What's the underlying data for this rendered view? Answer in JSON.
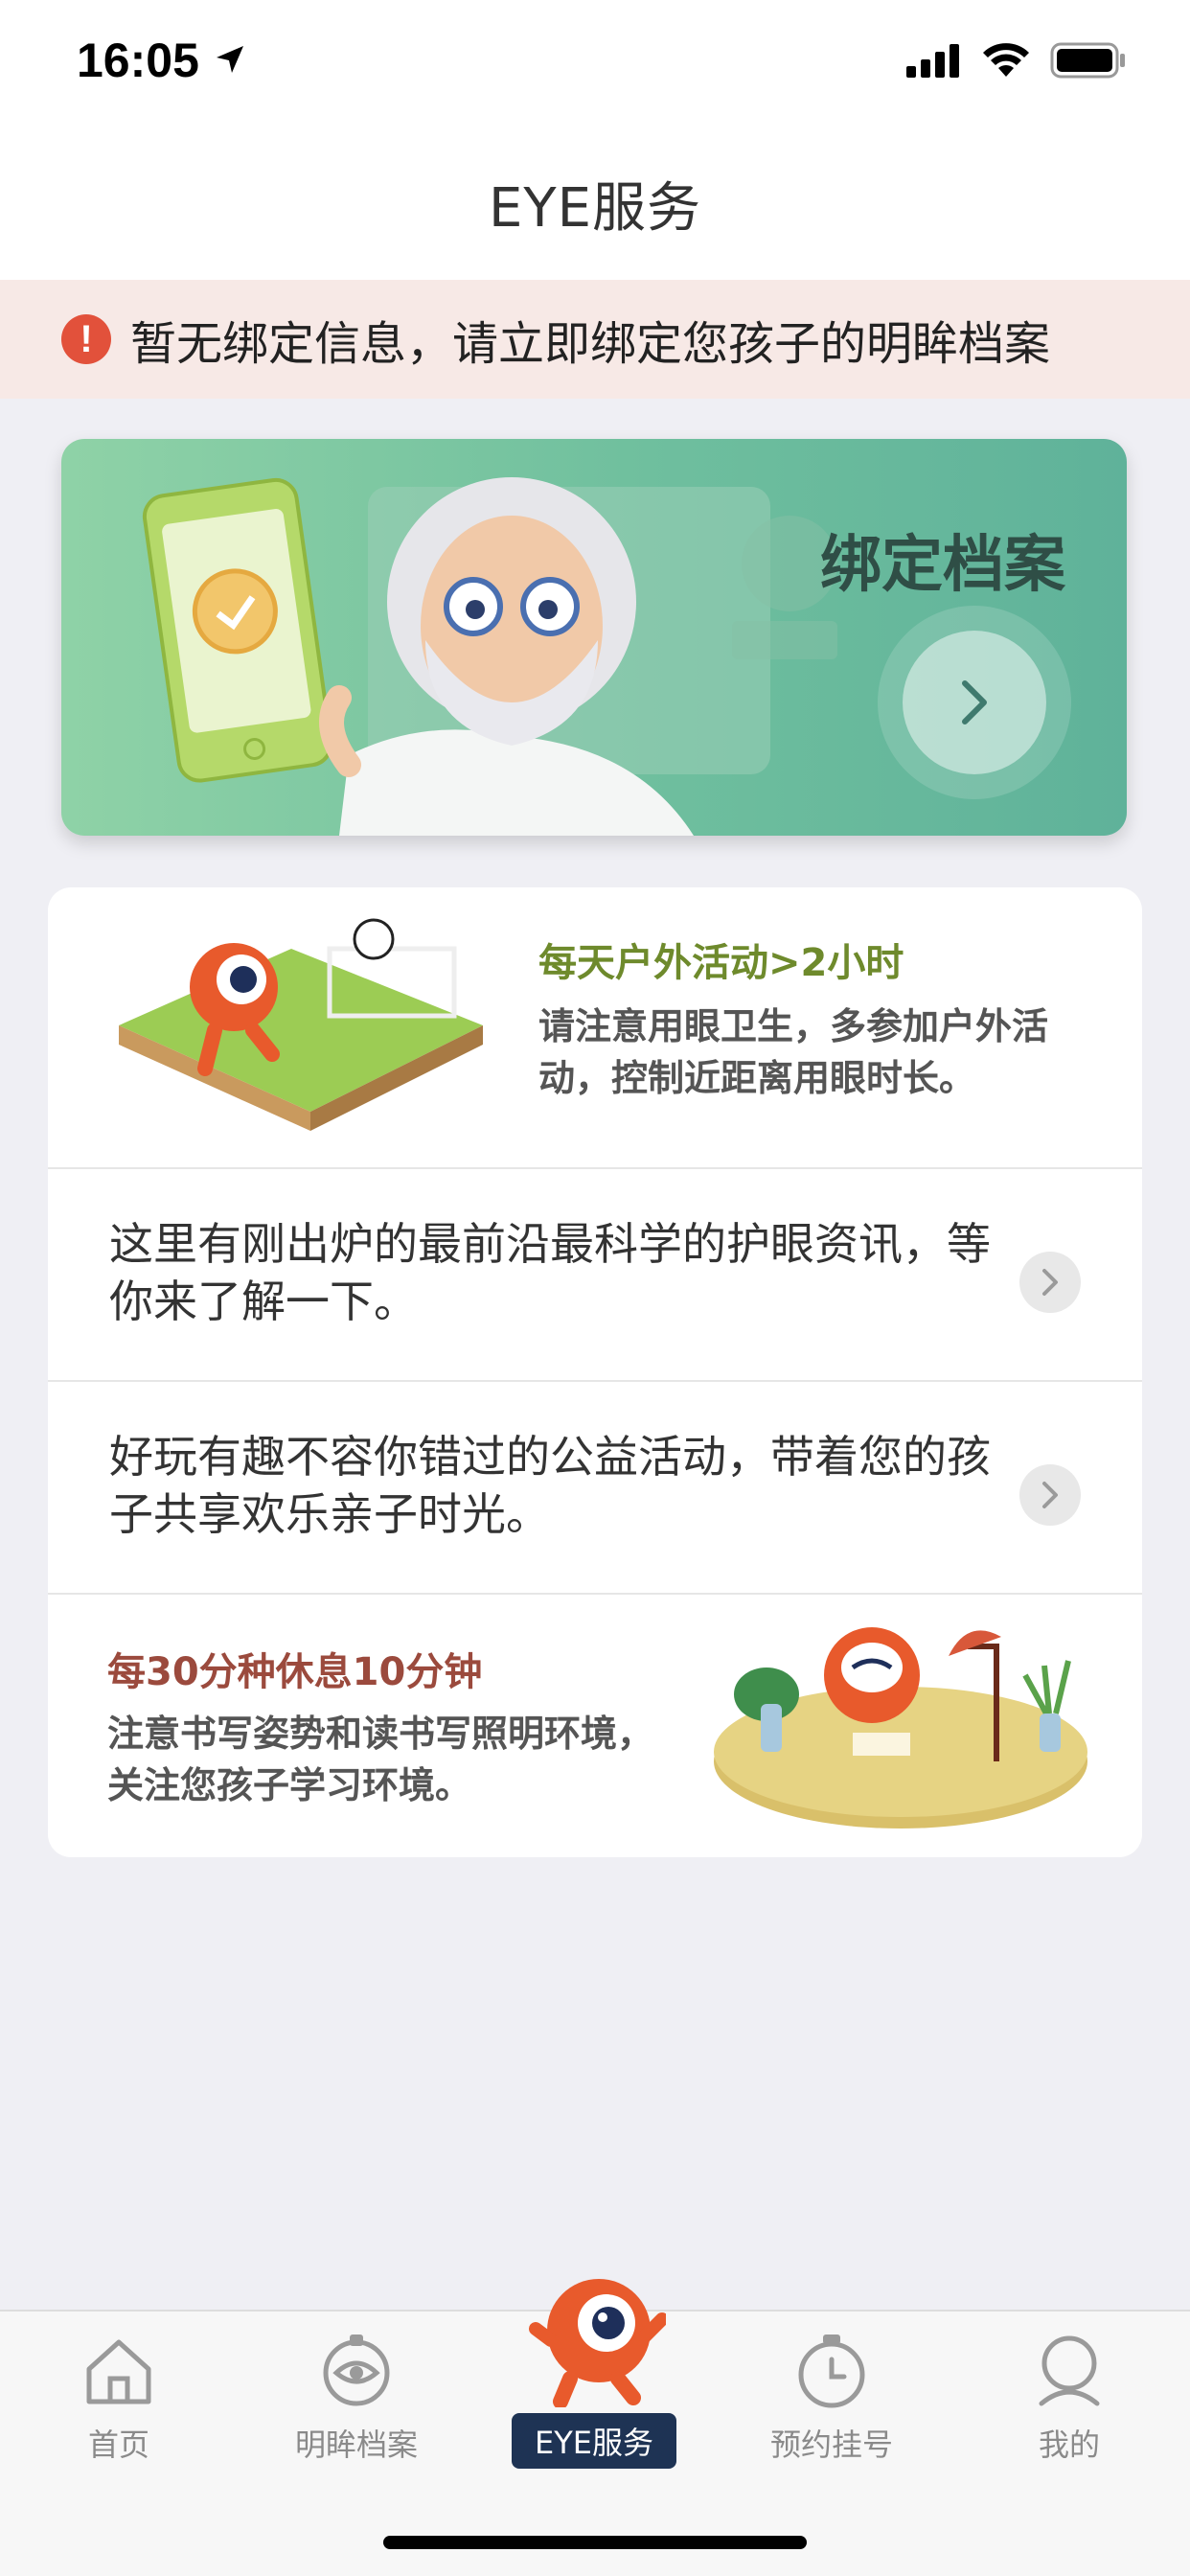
{
  "status_bar": {
    "time": "16:05"
  },
  "nav": {
    "title": "EYE服务"
  },
  "notice": {
    "text": "暂无绑定信息，请立即绑定您孩子的明眸档案"
  },
  "banner": {
    "title": "绑定档案"
  },
  "tips": {
    "outdoor": {
      "title": "每天户外活动>2小时",
      "desc": "请注意用眼卫生，多参加户外活动，控制近距离用眼时长。"
    },
    "news": {
      "text": "这里有刚出炉的最前沿最科学的护眼资讯，等你来了解一下。"
    },
    "activity": {
      "text": "好玩有趣不容你错过的公益活动，带着您的孩子共享欢乐亲子时光。"
    },
    "rest": {
      "title": "每30分种休息10分钟",
      "desc": "注意书写姿势和读书写照明环境，关注您孩子学习环境。"
    }
  },
  "tab_bar": {
    "items": [
      {
        "label": "首页",
        "icon": "home-icon"
      },
      {
        "label": "明眸档案",
        "icon": "eye-icon"
      },
      {
        "label": "EYE服务",
        "icon": "mascot-icon"
      },
      {
        "label": "预约挂号",
        "icon": "clock-icon"
      },
      {
        "label": "我的",
        "icon": "user-icon"
      }
    ],
    "active_index": 2
  },
  "colors": {
    "accent_dark": "#1e3354",
    "notice_bg": "#f7e9e6",
    "banner_green": "#6fbf9e",
    "tip_green": "#6e8a2c",
    "tip_red": "#9b4a3d"
  }
}
